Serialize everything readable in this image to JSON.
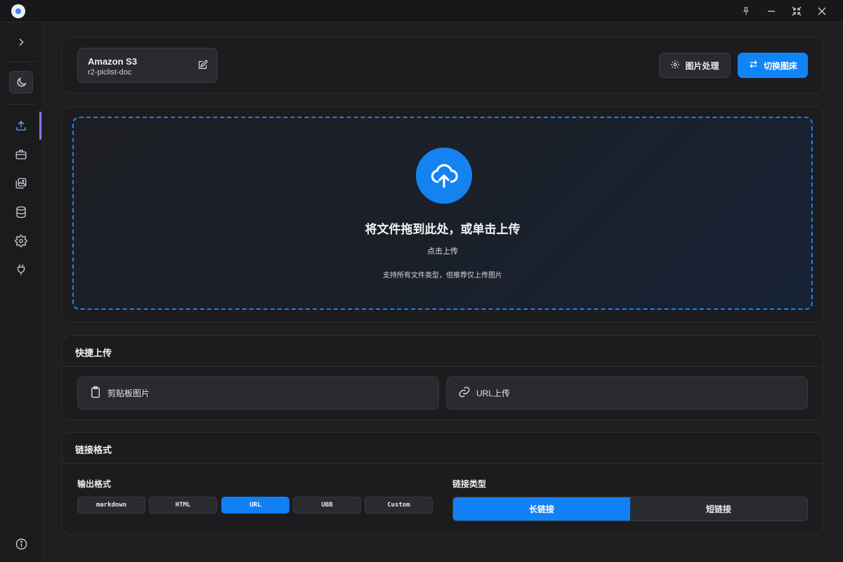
{
  "picbed": {
    "name": "Amazon S3",
    "config": "r2-piclist-doc"
  },
  "header_actions": {
    "image_process": "图片处理",
    "switch_bed": "切换图床"
  },
  "dropzone": {
    "main_text": "将文件拖到此处，或单击上传",
    "click_text": "点击上传",
    "hint": "支持所有文件类型，但推荐仅上传图片"
  },
  "quick_upload": {
    "title": "快捷上传",
    "clipboard": "剪贴板图片",
    "url": "URL上传"
  },
  "link_format": {
    "title": "链接格式",
    "output_label": "输出格式",
    "formats": [
      "markdown",
      "HTML",
      "URL",
      "UBB",
      "Custom"
    ],
    "selected_format": "URL",
    "type_label": "链接类型",
    "types": [
      "长链接",
      "短链接"
    ],
    "selected_type": "长链接"
  },
  "colors": {
    "accent": "#0f84f5",
    "background": "#1f1f22",
    "nav_active": "#7c7cf5"
  },
  "icons": {
    "sidebar": [
      "chevron-right-icon",
      "moon-icon",
      "upload-icon",
      "briefcase-icon",
      "gallery-icon",
      "database-icon",
      "gear-icon",
      "plug-icon",
      "info-icon"
    ],
    "titlebar": [
      "pin-icon",
      "minimize-icon",
      "restore-icon",
      "close-icon"
    ]
  }
}
